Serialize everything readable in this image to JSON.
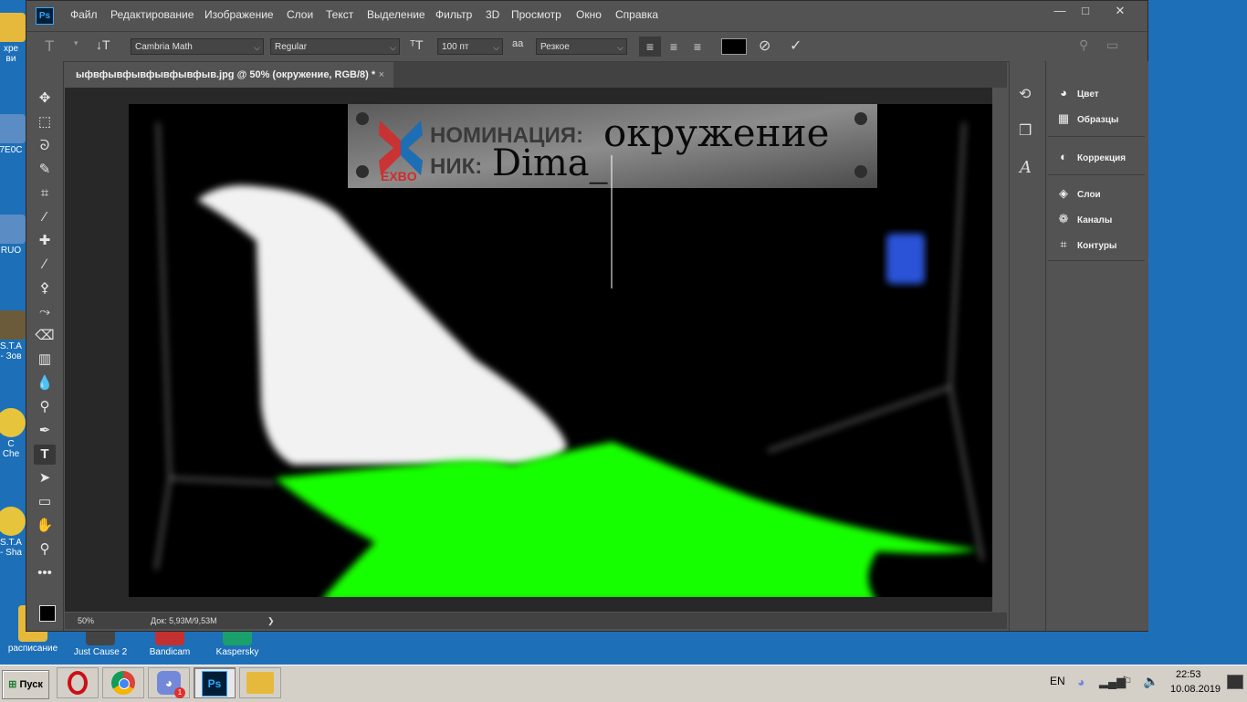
{
  "desktop": {
    "icons": [
      {
        "label": "хре\nви",
        "color": "#e6b93c"
      },
      {
        "label": "7E0C",
        "color": "#5b8cc4"
      },
      {
        "label": "RUO",
        "color": "#5b8cc4"
      },
      {
        "label": "S.T.A\n- Зов",
        "color": "#6b5b3a"
      },
      {
        "label": "C\nChe",
        "color": "#e6c43c"
      },
      {
        "label": "S.T.A\n- Sha",
        "color": "#6b5b3a"
      },
      {
        "label": "расписание",
        "color": "#e6b93c"
      },
      {
        "label": "Just Cause 2",
        "color": "#444"
      },
      {
        "label": "Bandicam",
        "color": "#c43030"
      },
      {
        "label": "Kaspersky",
        "color": "#1aa06a"
      }
    ]
  },
  "app": {
    "logo": "Ps",
    "menu": [
      "Файл",
      "Редактирование",
      "Изображение",
      "Слои",
      "Текст",
      "Выделение",
      "Фильтр",
      "3D",
      "Просмотр",
      "Окно",
      "Справка"
    ],
    "window_buttons": {
      "minimize": "—",
      "restore": "□",
      "close": "✕"
    }
  },
  "options": {
    "font_family": "Cambria Math",
    "font_style": "Regular",
    "font_size": "100 пт",
    "antialias_icon": "aa",
    "antialias": "Резкое",
    "text_color": "#000000"
  },
  "document": {
    "tab_title": "ыфвфывфывфывфывфыв.jpg @ 50% (окружение, RGB/8) *",
    "tab_close": "×",
    "zoom": "50%",
    "doc_size": "Док: 5,93M/9,53M",
    "status_arrow": "❯"
  },
  "banner": {
    "logo_text": "EXBO",
    "nomination_label": "НОМИНАЦИЯ:",
    "nomination_value": "окружение",
    "nick_label": "НИК:",
    "nick_value": "Dima_"
  },
  "panels": [
    {
      "label": "Цвет",
      "icon": "palette-icon",
      "glyph": "◕"
    },
    {
      "label": "Образцы",
      "icon": "swatches-icon",
      "glyph": "▦"
    },
    {
      "label": "Коррекция",
      "icon": "adjustments-icon",
      "glyph": "◐"
    },
    {
      "label": "Слои",
      "icon": "layers-icon",
      "glyph": "◈"
    },
    {
      "label": "Каналы",
      "icon": "channels-icon",
      "glyph": "❁"
    },
    {
      "label": "Контуры",
      "icon": "paths-icon",
      "glyph": "⌗"
    }
  ],
  "taskbar": {
    "start_label": "Пуск",
    "language": "EN",
    "time": "22:53",
    "date": "10.08.2019",
    "discord_badge": "1",
    "apps": [
      {
        "name": "opera-taskbar-button",
        "color": "#cc0f16",
        "glyph": "O"
      },
      {
        "name": "chrome-taskbar-button",
        "color": "#2f9c45",
        "glyph": "◉"
      },
      {
        "name": "discord-taskbar-button",
        "color": "#7289da",
        "glyph": "◕"
      },
      {
        "name": "photoshop-taskbar-button",
        "color": "#001e36",
        "glyph": "Ps"
      },
      {
        "name": "explorer-taskbar-button",
        "color": "#e6b93c",
        "glyph": "▤"
      }
    ]
  }
}
